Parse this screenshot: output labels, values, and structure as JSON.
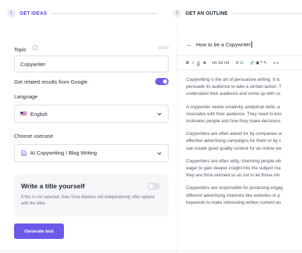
{
  "steps": [
    {
      "number": "1",
      "label": "GET IDEAS"
    },
    {
      "number": "2",
      "label": "GET AN OUTLINE"
    }
  ],
  "form": {
    "topic_label": "Topic",
    "topic_counter": "0/300",
    "topic_value": "Copywriter",
    "google_label": "Get related results from Google",
    "google_enabled": true,
    "language_label": "Language",
    "language_value": "English",
    "usecase_label": "Choose usecase",
    "usecase_value": "AI Copywriting / Blog Writing",
    "title_card": {
      "heading": "Write a title yourself",
      "description": "If this is not selected, then Tone Masters will independently offer options with the titles",
      "enabled": false
    },
    "generate_label": "Generate text"
  },
  "editor": {
    "back_icon": "arrow-left-icon",
    "title": "How to be a Copywriter",
    "toolbar": {
      "bold": "B",
      "italic": "I",
      "underline": "U",
      "strike": "S",
      "headings": "H1 H2 H3",
      "lists": "☰ ☷",
      "insert": "🔗 ▣ ❞ ✎",
      "align": "≡ ≡"
    },
    "paragraphs": [
      [
        "Copywriting is the art of persuasive writing. It is",
        "persuade its audience to take a certain action. T",
        "understand their audience and come up with co"
      ],
      [
        "A copywriter needs creativity, analytical skills, a",
        "resonates with their audience. They need to kno",
        "motivates people and how they make decisions."
      ],
      [
        "Copywriters are often asked for by companies w",
        "effective advertising campaigns for them or by c",
        "can create good quality content for an online we"
      ],
      [
        "Copywriters are often witty, charming people wh",
        "eager to gain deeper insight into the subject ma",
        "they are thick-skinned so as not to let those mir"
      ],
      [
        "Copywriters are responsible for producing engag",
        "different advertising channels like websites or p",
        "keywords to make interesting written content an"
      ]
    ]
  },
  "colors": {
    "accent": "#6a5be8",
    "step_active_text": "#5a4bd6"
  }
}
